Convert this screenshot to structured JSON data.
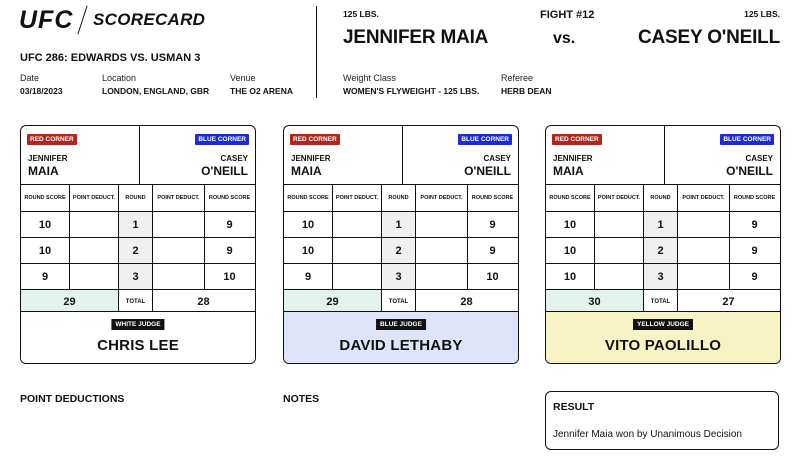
{
  "header": {
    "logo": "UFC",
    "title": "SCORECARD",
    "event": "UFC 286: EDWARDS VS. USMAN 3",
    "meta": [
      {
        "label": "Date",
        "value": "03/18/2023"
      },
      {
        "label": "Location",
        "value": "LONDON, ENGLAND, GBR"
      },
      {
        "label": "Venue",
        "value": "THE O2 ARENA"
      },
      {
        "label": "Weight Class",
        "value": "WOMEN'S FLYWEIGHT - 125 LBS."
      },
      {
        "label": "Referee",
        "value": "HERB DEAN"
      }
    ],
    "fight_number": "FIGHT #12",
    "vs": "vs.",
    "fighter_left": {
      "weight": "125 LBS.",
      "name": "JENNIFER MAIA"
    },
    "fighter_right": {
      "weight": "125 LBS.",
      "name": "CASEY O'NEILL"
    }
  },
  "card_labels": {
    "red_corner": "RED CORNER",
    "blue_corner": "BLUE CORNER",
    "round_score": "ROUND SCORE",
    "point_deduct": "POINT DEDUCT.",
    "round": "ROUND",
    "total": "TOTAL"
  },
  "fighters_short": {
    "left_first": "JENNIFER",
    "left_last": "MAIA",
    "right_first": "CASEY",
    "right_last": "O'NEILL"
  },
  "cards": [
    {
      "judge_label": "WHITE JUDGE",
      "judge_name": "CHRIS LEE",
      "judge_color": "#ffffff",
      "rounds": [
        {
          "round": "1",
          "left": "10",
          "right": "9"
        },
        {
          "round": "2",
          "left": "10",
          "right": "9"
        },
        {
          "round": "3",
          "left": "9",
          "right": "10"
        }
      ],
      "total_left": "29",
      "total_right": "28"
    },
    {
      "judge_label": "BLUE JUDGE",
      "judge_name": "DAVID LETHABY",
      "judge_color": "#dfe4fa",
      "rounds": [
        {
          "round": "1",
          "left": "10",
          "right": "9"
        },
        {
          "round": "2",
          "left": "10",
          "right": "9"
        },
        {
          "round": "3",
          "left": "9",
          "right": "10"
        }
      ],
      "total_left": "29",
      "total_right": "28"
    },
    {
      "judge_label": "YELLOW JUDGE",
      "judge_name": "VITO PAOLILLO",
      "judge_color": "#f8f3c4",
      "rounds": [
        {
          "round": "1",
          "left": "10",
          "right": "9"
        },
        {
          "round": "2",
          "left": "10",
          "right": "9"
        },
        {
          "round": "3",
          "left": "10",
          "right": "9"
        }
      ],
      "total_left": "30",
      "total_right": "27"
    }
  ],
  "bottom": {
    "point_deductions_title": "POINT DEDUCTIONS",
    "notes_title": "NOTES",
    "result_title": "RESULT",
    "result_text": "Jennifer Maia won by Unanimous Decision"
  },
  "colors": {
    "red_corner": "#b3261e",
    "blue_corner": "#1d2bd6",
    "winner_total": "#e2f3ec"
  }
}
